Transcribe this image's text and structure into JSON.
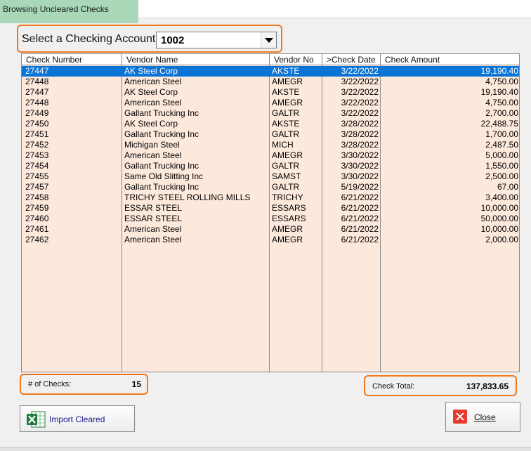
{
  "window": {
    "title": "Browsing Uncleared Checks"
  },
  "account": {
    "label": "Select a Checking Account:",
    "value": "1002"
  },
  "columns": [
    "Check Number",
    "Vendor Name",
    "Vendor No",
    ">Check Date",
    "Check Amount"
  ],
  "rows": [
    [
      "27447",
      "AK Steel Corp",
      "AKSTE",
      "3/22/2022",
      "19,190.40"
    ],
    [
      "27448",
      "American Steel",
      "AMEGR",
      "3/22/2022",
      "4,750.00"
    ],
    [
      "27447",
      "AK Steel Corp",
      "AKSTE",
      "3/22/2022",
      "19,190.40"
    ],
    [
      "27448",
      "American Steel",
      "AMEGR",
      "3/22/2022",
      "4,750.00"
    ],
    [
      "27449",
      "Gallant Trucking Inc",
      "GALTR",
      "3/22/2022",
      "2,700.00"
    ],
    [
      "27450",
      "AK Steel Corp",
      "AKSTE",
      "3/28/2022",
      "22,488.75"
    ],
    [
      "27451",
      "Gallant Trucking Inc",
      "GALTR",
      "3/28/2022",
      "1,700.00"
    ],
    [
      "27452",
      "Michigan Steel",
      "MICH",
      "3/28/2022",
      "2,487.50"
    ],
    [
      "27453",
      "American Steel",
      "AMEGR",
      "3/30/2022",
      "5,000.00"
    ],
    [
      "27454",
      "Gallant Trucking Inc",
      "GALTR",
      "3/30/2022",
      "1,550.00"
    ],
    [
      "27455",
      "Same Old Slitting Inc",
      "SAMST",
      "3/30/2022",
      "2,500.00"
    ],
    [
      "27457",
      "Gallant Trucking Inc",
      "GALTR",
      "5/19/2022",
      "67.00"
    ],
    [
      "27458",
      "TRICHY STEEL ROLLING MILLS",
      "TRICHY",
      "6/21/2022",
      "3,400.00"
    ],
    [
      "27459",
      " ESSAR STEEL",
      "ESSARS",
      "6/21/2022",
      "10,000.00"
    ],
    [
      "27460",
      " ESSAR STEEL",
      "ESSARS",
      "6/21/2022",
      "50,000.00"
    ],
    [
      "27461",
      "American Steel",
      "AMEGR",
      "6/21/2022",
      "10,000.00"
    ],
    [
      "27462",
      "American Steel",
      "AMEGR",
      "6/21/2022",
      "2,000.00"
    ]
  ],
  "selected_row": 0,
  "summary": {
    "count_label": "# of Checks:",
    "count_value": "15",
    "total_label": "Check Total:",
    "total_value": "137,833.65"
  },
  "buttons": {
    "import_label": "Import Cleared",
    "close_label": "Close"
  },
  "icons": {
    "import": "excel-icon",
    "close": "close-icon"
  },
  "colors": {
    "accent": "#f07820",
    "grid_bg": "#fde8dc",
    "selection": "#0a73d6",
    "title_tab": "#a8d8b8"
  }
}
